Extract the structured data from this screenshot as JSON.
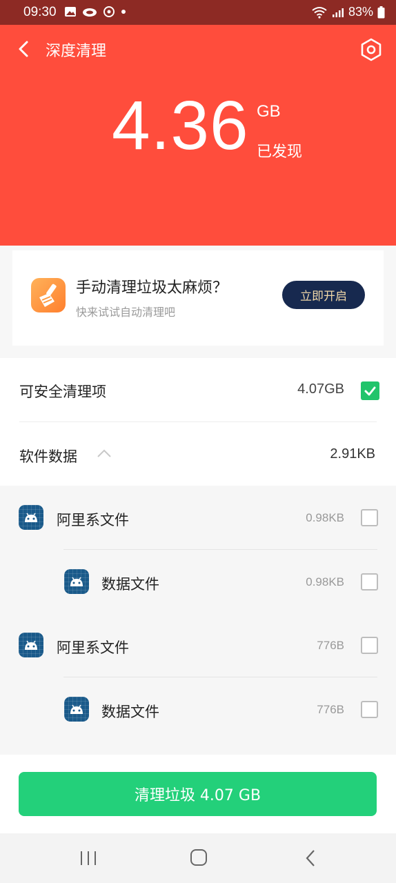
{
  "status_bar": {
    "time": "09:30",
    "battery": "83%"
  },
  "header": {
    "title": "深度清理",
    "amount": "4.36",
    "unit": "GB",
    "found_label": "已发现"
  },
  "promo": {
    "title": "手动清理垃圾太麻烦？",
    "subtitle": "快来试试自动清理吧",
    "button_label": "立即开启"
  },
  "safe_clean": {
    "label": "可安全清理项",
    "size": "4.07GB",
    "checked": true
  },
  "software_data": {
    "label": "软件数据",
    "size": "2.91KB",
    "expanded": true
  },
  "items": [
    {
      "name": "阿里系文件",
      "size": "0.98KB",
      "level": 0,
      "checked": false
    },
    {
      "name": "数据文件",
      "size": "0.98KB",
      "level": 1,
      "checked": false
    },
    {
      "name": "阿里系文件",
      "size": "776B",
      "level": 0,
      "checked": false
    },
    {
      "name": "数据文件",
      "size": "776B",
      "level": 1,
      "checked": false
    }
  ],
  "clean_button": {
    "label": "清理垃圾 4.07 GB"
  },
  "colors": {
    "header_bg": "#ff4d3c",
    "status_bg": "#8d2a24",
    "accent_green": "#23d07a",
    "promo_button_bg": "#17294f"
  }
}
